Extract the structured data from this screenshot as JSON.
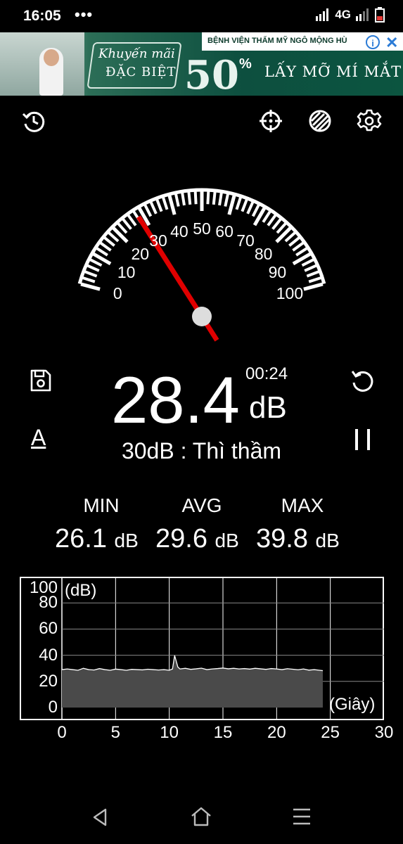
{
  "status_bar": {
    "time": "16:05",
    "dots": "•••",
    "network": "4G"
  },
  "ad": {
    "header": "BỆNH VIỆN THẨM MỸ NGÔ MỘNG HÙ",
    "promo_line1": "Khuyến mãi",
    "promo_line2": "ĐẶC BIỆT",
    "discount": "50",
    "percent": "%",
    "tagline": "LẤY MỠ MÍ MẮT",
    "info_icon": "info-icon",
    "close_icon": "close-icon"
  },
  "toolbar": {
    "left_icon": "history-icon",
    "right_icons": [
      "crosshair-icon",
      "calibrate-icon",
      "settings-icon"
    ]
  },
  "gauge": {
    "labels": [
      "0",
      "10",
      "20",
      "30",
      "40",
      "50",
      "60",
      "70",
      "80",
      "90",
      "100"
    ],
    "needle_value": 28.4,
    "min": 0,
    "max": 100
  },
  "reading": {
    "value": "28.4",
    "unit": "dB",
    "elapsed": "00:24",
    "description": "30dB : Thì thầm",
    "weighting": "A"
  },
  "side_icons": {
    "save": "save-icon",
    "reset": "reset-icon",
    "pause": "pause-icon"
  },
  "stats": {
    "min_label": "MIN",
    "min_value": "26.1",
    "min_unit": "dB",
    "avg_label": "AVG",
    "avg_value": "29.6",
    "avg_unit": "dB",
    "max_label": "MAX",
    "max_value": "39.8",
    "max_unit": "dB"
  },
  "chart_data": {
    "type": "area",
    "ylabel": "(dB)",
    "xlabel": "(Giây)",
    "y_ticks": [
      "0",
      "20",
      "40",
      "60",
      "80",
      "100"
    ],
    "x_ticks": [
      "0",
      "5",
      "10",
      "15",
      "20",
      "25",
      "30"
    ],
    "xlim": [
      0,
      30
    ],
    "ylim": [
      0,
      100
    ],
    "x": [
      0,
      0.5,
      1,
      1.5,
      2,
      2.5,
      3,
      3.5,
      4,
      4.5,
      5,
      5.5,
      6,
      6.5,
      7,
      7.5,
      8,
      8.5,
      9,
      9.5,
      10,
      10.3,
      10.5,
      10.8,
      11,
      11.5,
      12,
      12.5,
      13,
      13.5,
      14,
      14.5,
      15,
      15.5,
      16,
      16.5,
      17,
      17.5,
      18,
      18.5,
      19,
      19.5,
      20,
      20.5,
      21,
      21.5,
      22,
      22.5,
      23,
      23.5,
      24,
      24.3
    ],
    "y": [
      29,
      29.5,
      29,
      28.5,
      30,
      29,
      28.7,
      29.8,
      29,
      28.5,
      29.4,
      29,
      28.5,
      29.2,
      29,
      28.8,
      29.3,
      29,
      28.7,
      29,
      28.5,
      29.5,
      39.8,
      31,
      29.5,
      30,
      29.2,
      29.6,
      30.1,
      29,
      29.5,
      29.8,
      30.2,
      29.6,
      30,
      29.5,
      29.8,
      29.4,
      30,
      29.6,
      29.2,
      29.8,
      29.5,
      29,
      29.7,
      29.3,
      28.9,
      29.5,
      28.6,
      29,
      28.5,
      28.2
    ],
    "grid": true
  },
  "navbar": {
    "back": "back-icon",
    "home": "home-icon",
    "menu": "menu-icon"
  }
}
